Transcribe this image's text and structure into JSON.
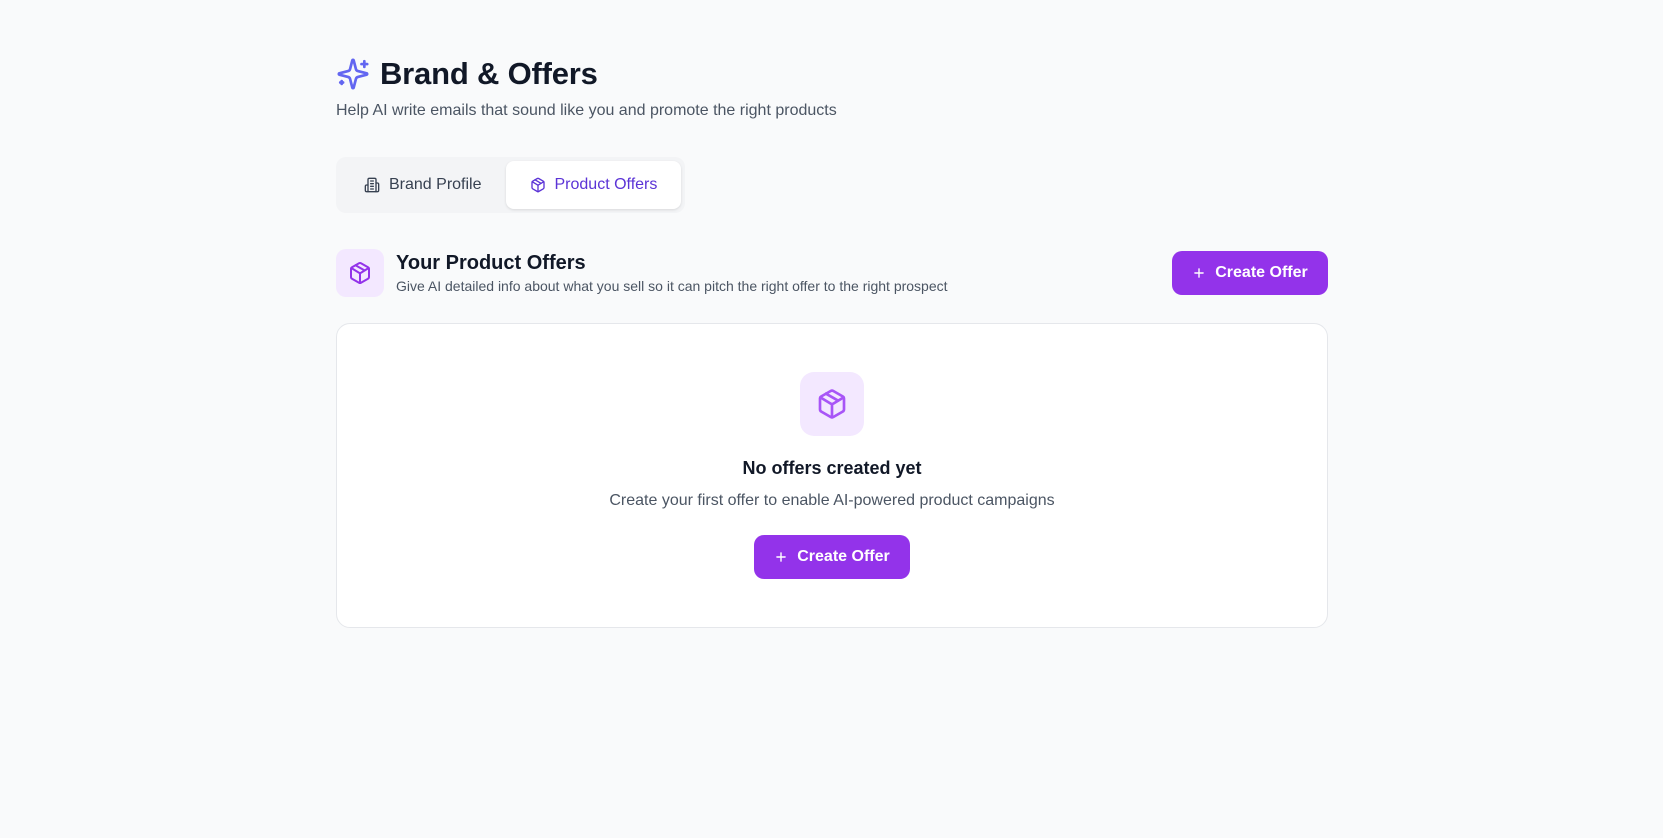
{
  "header": {
    "title": "Brand & Offers",
    "subtitle": "Help AI write emails that sound like you and promote the right products",
    "icon": "sparkles-icon"
  },
  "tabs": [
    {
      "label": "Brand Profile",
      "icon": "building-icon",
      "active": false
    },
    {
      "label": "Product Offers",
      "icon": "package-icon",
      "active": true
    }
  ],
  "section": {
    "title": "Your Product Offers",
    "description": "Give AI detailed info about what you sell so it can pitch the right offer to the right prospect",
    "icon": "package-icon",
    "create_button_label": "Create Offer"
  },
  "empty_state": {
    "title": "No offers created yet",
    "description": "Create your first offer to enable AI-powered product campaigns",
    "button_label": "Create Offer",
    "icon": "package-icon"
  },
  "colors": {
    "accent": "#9333ea",
    "accent_soft": "#f3e8ff",
    "active_tab_text": "#5b33d6",
    "title_icon": "#6366f1",
    "background": "#f9fafb"
  }
}
